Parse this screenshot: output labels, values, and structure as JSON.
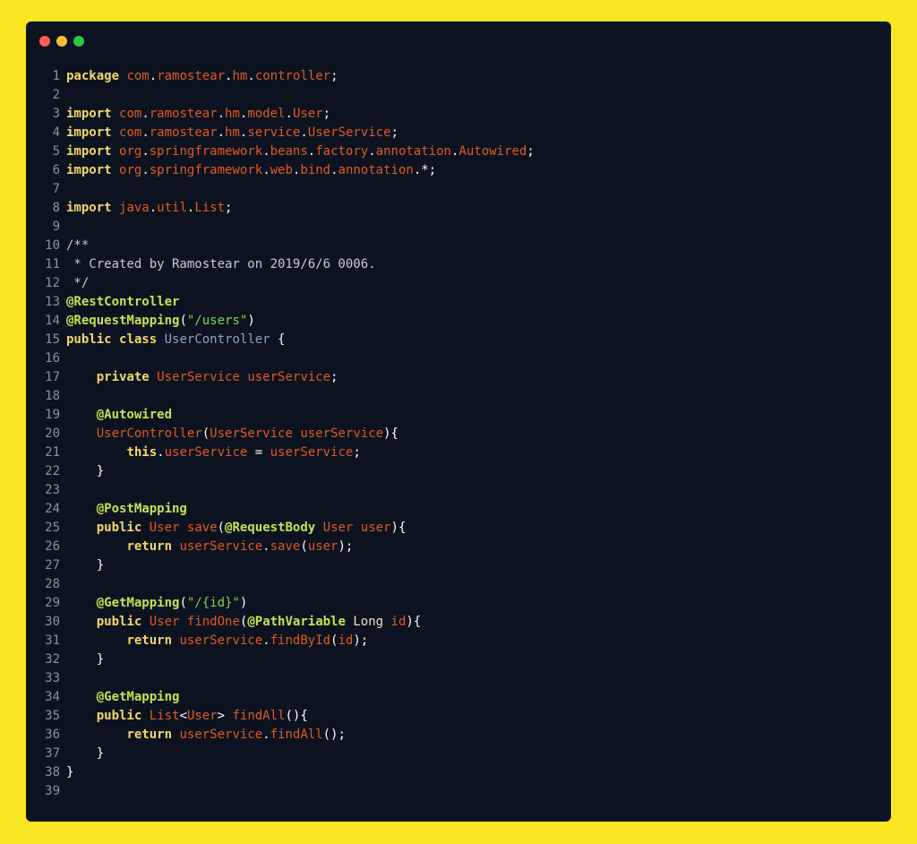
{
  "window": {
    "dots": [
      {
        "name": "close",
        "color": "#ff5f57"
      },
      {
        "name": "minimize",
        "color": "#febc2e"
      },
      {
        "name": "maximize",
        "color": "#28c840"
      }
    ]
  },
  "token_colors": {
    "keyword": "#f1d96b",
    "annotation": "#c4e455",
    "identifier": "#e05a25",
    "punctuation": "#ffffff",
    "string": "#7fd65a",
    "comment": "#c8cbd6",
    "type": "#ece2c0",
    "class_name": "#8ea5c7"
  },
  "code": {
    "language": "java",
    "lines": [
      {
        "n": "1",
        "tokens": [
          [
            "k",
            "package"
          ],
          [
            "p",
            " "
          ],
          [
            "i",
            "com"
          ],
          [
            "p",
            "."
          ],
          [
            "i",
            "ramostear"
          ],
          [
            "p",
            "."
          ],
          [
            "i",
            "hm"
          ],
          [
            "p",
            "."
          ],
          [
            "i",
            "controller"
          ],
          [
            "p",
            ";"
          ]
        ]
      },
      {
        "n": "2",
        "tokens": []
      },
      {
        "n": "3",
        "tokens": [
          [
            "k",
            "import"
          ],
          [
            "p",
            " "
          ],
          [
            "i",
            "com"
          ],
          [
            "p",
            "."
          ],
          [
            "i",
            "ramostear"
          ],
          [
            "p",
            "."
          ],
          [
            "i",
            "hm"
          ],
          [
            "p",
            "."
          ],
          [
            "i",
            "model"
          ],
          [
            "p",
            "."
          ],
          [
            "i",
            "User"
          ],
          [
            "p",
            ";"
          ]
        ]
      },
      {
        "n": "4",
        "tokens": [
          [
            "k",
            "import"
          ],
          [
            "p",
            " "
          ],
          [
            "i",
            "com"
          ],
          [
            "p",
            "."
          ],
          [
            "i",
            "ramostear"
          ],
          [
            "p",
            "."
          ],
          [
            "i",
            "hm"
          ],
          [
            "p",
            "."
          ],
          [
            "i",
            "service"
          ],
          [
            "p",
            "."
          ],
          [
            "i",
            "UserService"
          ],
          [
            "p",
            ";"
          ]
        ]
      },
      {
        "n": "5",
        "tokens": [
          [
            "k",
            "import"
          ],
          [
            "p",
            " "
          ],
          [
            "i",
            "org"
          ],
          [
            "p",
            "."
          ],
          [
            "i",
            "springframework"
          ],
          [
            "p",
            "."
          ],
          [
            "i",
            "beans"
          ],
          [
            "p",
            "."
          ],
          [
            "i",
            "factory"
          ],
          [
            "p",
            "."
          ],
          [
            "i",
            "annotation"
          ],
          [
            "p",
            "."
          ],
          [
            "i",
            "Autowired"
          ],
          [
            "p",
            ";"
          ]
        ]
      },
      {
        "n": "6",
        "tokens": [
          [
            "k",
            "import"
          ],
          [
            "p",
            " "
          ],
          [
            "i",
            "org"
          ],
          [
            "p",
            "."
          ],
          [
            "i",
            "springframework"
          ],
          [
            "p",
            "."
          ],
          [
            "i",
            "web"
          ],
          [
            "p",
            "."
          ],
          [
            "i",
            "bind"
          ],
          [
            "p",
            "."
          ],
          [
            "i",
            "annotation"
          ],
          [
            "p",
            ".*;"
          ]
        ]
      },
      {
        "n": "7",
        "tokens": []
      },
      {
        "n": "8",
        "tokens": [
          [
            "k",
            "import"
          ],
          [
            "p",
            " "
          ],
          [
            "i",
            "java"
          ],
          [
            "p",
            "."
          ],
          [
            "i",
            "util"
          ],
          [
            "p",
            "."
          ],
          [
            "i",
            "List"
          ],
          [
            "p",
            ";"
          ]
        ]
      },
      {
        "n": "9",
        "tokens": []
      },
      {
        "n": "10",
        "tokens": [
          [
            "c",
            "/**"
          ]
        ]
      },
      {
        "n": "11",
        "tokens": [
          [
            "c",
            " * Created by Ramostear on 2019/6/6 0006."
          ]
        ]
      },
      {
        "n": "12",
        "tokens": [
          [
            "c",
            " */"
          ]
        ]
      },
      {
        "n": "13",
        "tokens": [
          [
            "a",
            "@RestController"
          ]
        ]
      },
      {
        "n": "14",
        "tokens": [
          [
            "a",
            "@RequestMapping"
          ],
          [
            "p",
            "("
          ],
          [
            "s",
            "\"/users\""
          ],
          [
            "p",
            ")"
          ]
        ]
      },
      {
        "n": "15",
        "tokens": [
          [
            "k",
            "public"
          ],
          [
            "p",
            " "
          ],
          [
            "k",
            "class"
          ],
          [
            "p",
            " "
          ],
          [
            "n",
            "UserController"
          ],
          [
            "p",
            " {"
          ]
        ]
      },
      {
        "n": "16",
        "tokens": []
      },
      {
        "n": "17",
        "tokens": [
          [
            "p",
            "    "
          ],
          [
            "k",
            "private"
          ],
          [
            "p",
            " "
          ],
          [
            "i",
            "UserService"
          ],
          [
            "p",
            " "
          ],
          [
            "v",
            "userService"
          ],
          [
            "p",
            ";"
          ]
        ]
      },
      {
        "n": "18",
        "tokens": []
      },
      {
        "n": "19",
        "tokens": [
          [
            "p",
            "    "
          ],
          [
            "a",
            "@Autowired"
          ]
        ]
      },
      {
        "n": "20",
        "tokens": [
          [
            "p",
            "    "
          ],
          [
            "i",
            "UserController"
          ],
          [
            "p",
            "("
          ],
          [
            "i",
            "UserService"
          ],
          [
            "p",
            " "
          ],
          [
            "v",
            "userService"
          ],
          [
            "p",
            "){"
          ]
        ]
      },
      {
        "n": "21",
        "tokens": [
          [
            "p",
            "        "
          ],
          [
            "k",
            "this"
          ],
          [
            "p",
            "."
          ],
          [
            "v",
            "userService"
          ],
          [
            "p",
            " = "
          ],
          [
            "v",
            "userService"
          ],
          [
            "p",
            ";"
          ]
        ]
      },
      {
        "n": "22",
        "tokens": [
          [
            "p",
            "    }"
          ]
        ]
      },
      {
        "n": "23",
        "tokens": []
      },
      {
        "n": "24",
        "tokens": [
          [
            "p",
            "    "
          ],
          [
            "a",
            "@PostMapping"
          ]
        ]
      },
      {
        "n": "25",
        "tokens": [
          [
            "p",
            "    "
          ],
          [
            "k",
            "public"
          ],
          [
            "p",
            " "
          ],
          [
            "i",
            "User"
          ],
          [
            "p",
            " "
          ],
          [
            "i",
            "save"
          ],
          [
            "p",
            "("
          ],
          [
            "a",
            "@RequestBody"
          ],
          [
            "p",
            " "
          ],
          [
            "i",
            "User"
          ],
          [
            "p",
            " "
          ],
          [
            "v",
            "user"
          ],
          [
            "p",
            "){"
          ]
        ]
      },
      {
        "n": "26",
        "tokens": [
          [
            "p",
            "        "
          ],
          [
            "k",
            "return"
          ],
          [
            "p",
            " "
          ],
          [
            "v",
            "userService"
          ],
          [
            "p",
            "."
          ],
          [
            "i",
            "save"
          ],
          [
            "p",
            "("
          ],
          [
            "v",
            "user"
          ],
          [
            "p",
            ");"
          ]
        ]
      },
      {
        "n": "27",
        "tokens": [
          [
            "p",
            "    }"
          ]
        ]
      },
      {
        "n": "28",
        "tokens": []
      },
      {
        "n": "29",
        "tokens": [
          [
            "p",
            "    "
          ],
          [
            "a",
            "@GetMapping"
          ],
          [
            "p",
            "("
          ],
          [
            "s",
            "\"/{id}\""
          ],
          [
            "p",
            ")"
          ]
        ]
      },
      {
        "n": "30",
        "tokens": [
          [
            "p",
            "    "
          ],
          [
            "k",
            "public"
          ],
          [
            "p",
            " "
          ],
          [
            "i",
            "User"
          ],
          [
            "p",
            " "
          ],
          [
            "i",
            "findOne"
          ],
          [
            "p",
            "("
          ],
          [
            "a",
            "@PathVariable"
          ],
          [
            "p",
            " "
          ],
          [
            "t",
            "Long"
          ],
          [
            "p",
            " "
          ],
          [
            "v",
            "id"
          ],
          [
            "p",
            "){"
          ]
        ]
      },
      {
        "n": "31",
        "tokens": [
          [
            "p",
            "        "
          ],
          [
            "k",
            "return"
          ],
          [
            "p",
            " "
          ],
          [
            "v",
            "userService"
          ],
          [
            "p",
            "."
          ],
          [
            "i",
            "findById"
          ],
          [
            "p",
            "("
          ],
          [
            "v",
            "id"
          ],
          [
            "p",
            ");"
          ]
        ]
      },
      {
        "n": "32",
        "tokens": [
          [
            "p",
            "    }"
          ]
        ]
      },
      {
        "n": "33",
        "tokens": []
      },
      {
        "n": "34",
        "tokens": [
          [
            "p",
            "    "
          ],
          [
            "a",
            "@GetMapping"
          ]
        ]
      },
      {
        "n": "35",
        "tokens": [
          [
            "p",
            "    "
          ],
          [
            "k",
            "public"
          ],
          [
            "p",
            " "
          ],
          [
            "i",
            "List"
          ],
          [
            "p",
            "<"
          ],
          [
            "i",
            "User"
          ],
          [
            "p",
            "> "
          ],
          [
            "i",
            "findAll"
          ],
          [
            "p",
            "(){"
          ]
        ]
      },
      {
        "n": "36",
        "tokens": [
          [
            "p",
            "        "
          ],
          [
            "k",
            "return"
          ],
          [
            "p",
            " "
          ],
          [
            "v",
            "userService"
          ],
          [
            "p",
            "."
          ],
          [
            "i",
            "findAll"
          ],
          [
            "p",
            "();"
          ]
        ]
      },
      {
        "n": "37",
        "tokens": [
          [
            "p",
            "    }"
          ]
        ]
      },
      {
        "n": "38",
        "tokens": [
          [
            "p",
            "}"
          ]
        ]
      },
      {
        "n": "39",
        "tokens": []
      }
    ]
  }
}
